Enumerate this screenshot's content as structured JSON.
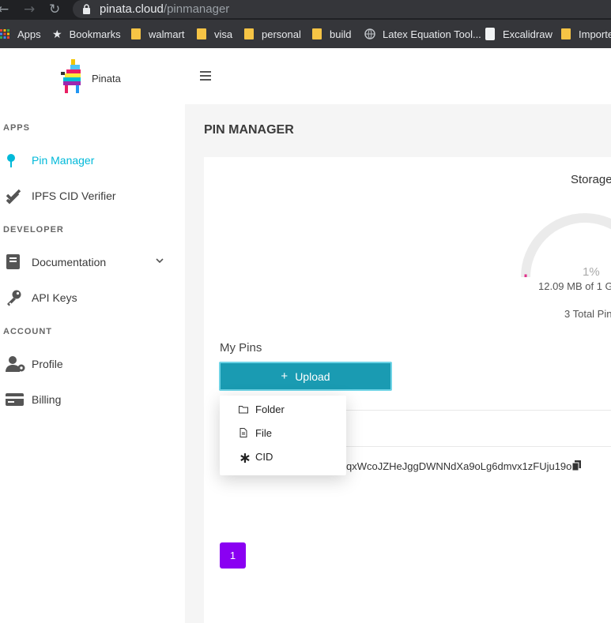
{
  "browser": {
    "url_host": "pinata.cloud",
    "url_path": "/pinmanager",
    "back_icon": "arrow-left-icon",
    "forward_icon": "arrow-right-icon",
    "reload_icon": "reload-icon",
    "bookmarks": [
      {
        "label": "Apps",
        "icon": "apps-grid-icon"
      },
      {
        "label": "Bookmarks",
        "icon": "star-icon"
      },
      {
        "label": "walmart",
        "icon": "folder-icon"
      },
      {
        "label": "visa",
        "icon": "folder-icon"
      },
      {
        "label": "personal",
        "icon": "folder-icon"
      },
      {
        "label": "build",
        "icon": "folder-icon"
      },
      {
        "label": "Latex Equation Tool...",
        "icon": "globe-icon"
      },
      {
        "label": "Excalidraw",
        "icon": "excalidraw-icon"
      },
      {
        "label": "Importe",
        "icon": "folder-icon"
      }
    ]
  },
  "header": {
    "brand": "Pinata",
    "menu_icon": "hamburger-icon"
  },
  "sidebar": {
    "sections": {
      "apps": "APPS",
      "developer": "DEVELOPER",
      "account": "ACCOUNT"
    },
    "items": [
      {
        "label": "Pin Manager",
        "icon": "pin-icon",
        "active": true
      },
      {
        "label": "IPFS CID Verifier",
        "icon": "double-check-icon"
      },
      {
        "label": "Documentation",
        "icon": "book-icon"
      },
      {
        "label": "API Keys",
        "icon": "key-icon"
      },
      {
        "label": "Profile",
        "icon": "user-gear-icon"
      },
      {
        "label": "Billing",
        "icon": "credit-card-icon"
      }
    ]
  },
  "main": {
    "title": "PIN MANAGER",
    "storage": {
      "title": "Storage",
      "percent": "1%",
      "percent_value": 1,
      "usage": "12.09 MB of 1 G",
      "total_pins": "3 Total Pin"
    },
    "my_pins_label": "My Pins",
    "upload_label": "Upload",
    "upload_menu": [
      {
        "label": "Folder",
        "icon": "folder-outline-icon"
      },
      {
        "label": "File",
        "icon": "file-icon"
      },
      {
        "label": "CID",
        "icon": "asterisk-icon"
      }
    ],
    "row_cid": "qxWcoJZHeJggDWNNdXa9oLg6dmvx1zFUju19o",
    "pagination": [
      "1"
    ]
  },
  "colors": {
    "accent": "#00b9d9",
    "upload_bg": "#1a9bb2",
    "page_active": "#8a00f2",
    "gauge_fill": "#e0308a"
  }
}
